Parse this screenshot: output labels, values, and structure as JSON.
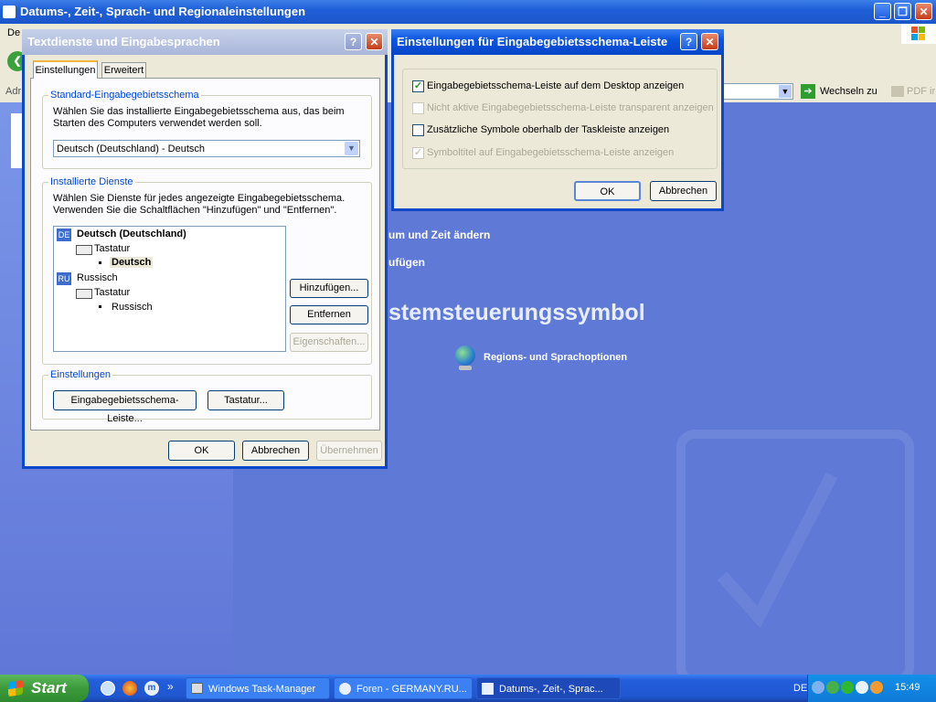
{
  "main_window": {
    "title": "Datums-, Zeit-, Sprach- und Regionaleinstellungen",
    "menu_partial": "De",
    "address_partial": "Adr",
    "go_label": "Wechseln zu",
    "pdf_label": "PDF ir",
    "links": [
      "um und Zeit ändern",
      "ufügen"
    ],
    "heading": "stemsteuerungssymbol",
    "icon_link": "Regions- und Sprachoptionen"
  },
  "textdienste": {
    "title": "Textdienste und Eingabesprachen",
    "tabs": [
      "Einstellungen",
      "Erweitert"
    ],
    "default_group": {
      "label": "Standard-Eingabegebietsschema",
      "description": "Wählen Sie das installierte Eingabegebietsschema aus, das beim Starten des Computers verwendet werden soll.",
      "selected": "Deutsch (Deutschland) - Deutsch"
    },
    "installed_group": {
      "label": "Installierte Dienste",
      "description": "Wählen Sie Dienste für jedes angezeigte Eingabegebietsschema. Verwenden Sie die Schaltflächen \"Hinzufügen\" und \"Entfernen\".",
      "tree": {
        "lang1_badge": "DE",
        "lang1": "Deutsch (Deutschland)",
        "lang1_sub": "Tastatur",
        "lang1_item": "Deutsch",
        "lang2_badge": "RU",
        "lang2": "Russisch",
        "lang2_sub": "Tastatur",
        "lang2_item": "Russisch"
      },
      "buttons": {
        "add": "Hinzufügen...",
        "remove": "Entfernen",
        "properties": "Eigenschaften..."
      }
    },
    "settings_group": {
      "label": "Einstellungen",
      "buttons": {
        "langbar": "Eingabegebietsschema-Leiste...",
        "keyboard": "Tastatur..."
      }
    },
    "buttons": {
      "ok": "OK",
      "cancel": "Abbrechen",
      "apply": "Übernehmen"
    }
  },
  "langbar_dialog": {
    "title": "Einstellungen für Eingabegebietsschema-Leiste",
    "options": [
      {
        "label": "Eingabegebietsschema-Leiste auf dem Desktop anzeigen",
        "checked": true,
        "enabled": true
      },
      {
        "label": "Nicht aktive Eingabegebietsschema-Leiste transparent anzeigen",
        "checked": false,
        "enabled": false
      },
      {
        "label": "Zusätzliche Symbole oberhalb der Taskleiste anzeigen",
        "checked": false,
        "enabled": true
      },
      {
        "label": "Symboltitel auf Eingabegebietsschema-Leiste anzeigen",
        "checked": true,
        "enabled": false
      }
    ],
    "buttons": {
      "ok": "OK",
      "cancel": "Abbrechen"
    }
  },
  "taskbar": {
    "start": "Start",
    "chevron": "»",
    "tasks": [
      "Windows Task-Manager",
      "Foren - GERMANY.RU...",
      "Datums-, Zeit-, Sprac..."
    ],
    "lang": "DE",
    "clock": "15:49"
  }
}
